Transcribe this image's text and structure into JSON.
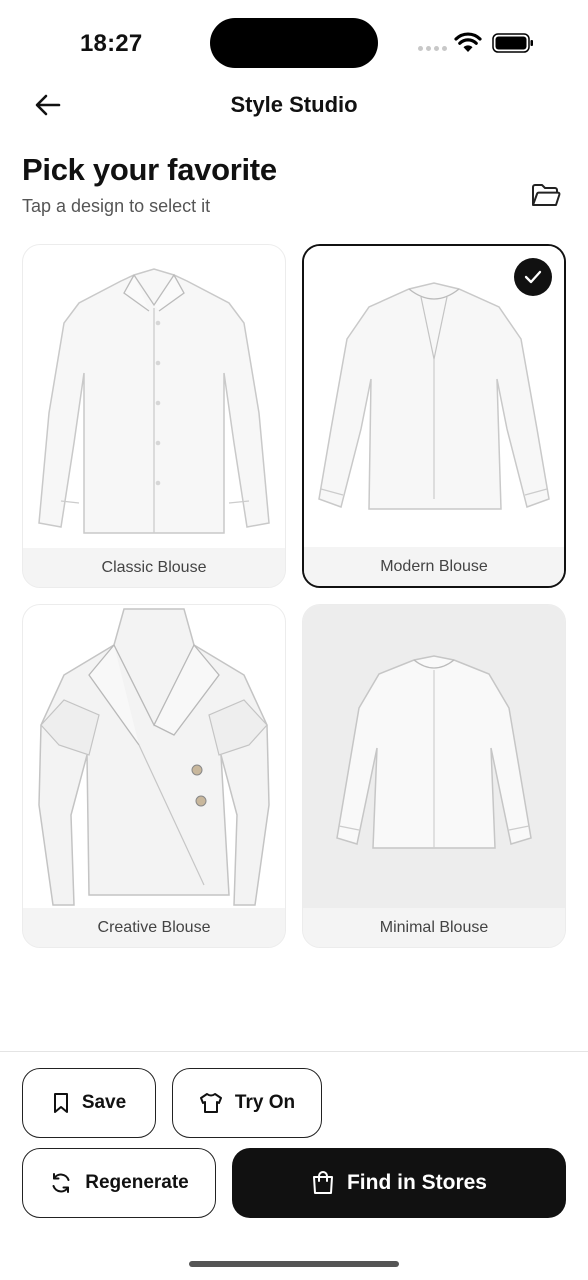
{
  "status_bar": {
    "time": "18:27"
  },
  "header": {
    "title": "Style Studio"
  },
  "intro": {
    "title": "Pick your favorite",
    "subtitle": "Tap a design to select it"
  },
  "designs": [
    {
      "label": "Classic Blouse",
      "selected": false
    },
    {
      "label": "Modern Blouse",
      "selected": true
    },
    {
      "label": "Creative Blouse",
      "selected": false
    },
    {
      "label": "Minimal Blouse",
      "selected": false
    }
  ],
  "actions": {
    "save": "Save",
    "try_on": "Try On",
    "regenerate": "Regenerate",
    "find_in_stores": "Find in Stores"
  },
  "icons": {
    "back": "arrow-left-icon",
    "folder": "folder-open-icon",
    "check": "check-icon",
    "save": "bookmark-icon",
    "try_on": "shirt-icon",
    "regenerate": "refresh-icon",
    "find_in_stores": "shopping-bag-icon"
  },
  "colors": {
    "primary": "#111111",
    "card_bg": "#f4f4f4",
    "muted_text": "#555555"
  }
}
